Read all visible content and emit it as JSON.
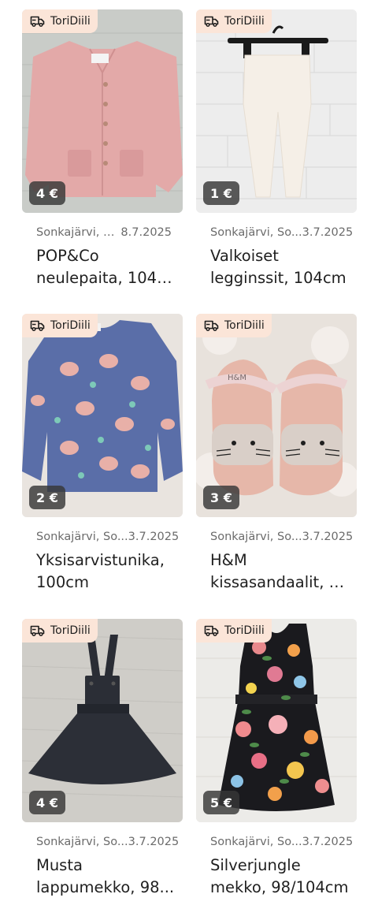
{
  "colors": {
    "badge_bg": "#fbe5d8",
    "price_bg": "#3a3a3a",
    "meta_text": "#6b6b6b",
    "title_text": "#1f1f1f"
  },
  "listings": [
    {
      "badge": "ToriDiili",
      "badge_icon": "delivery-truck-icon",
      "price": "4 €",
      "location": "Sonkajärvi, S...",
      "date": "8.7.2025",
      "title_line1": "POP&Co",
      "title_line2": "neulepaita, 104c...",
      "image": "pink-cardigan"
    },
    {
      "badge": "ToriDiili",
      "badge_icon": "delivery-truck-icon",
      "price": "1 €",
      "location": "Sonkajärvi, So...",
      "date": "3.7.2025",
      "title_line1": "Valkoiset",
      "title_line2": "legginssit, 104cm",
      "image": "white-leggings"
    },
    {
      "badge": "ToriDiili",
      "badge_icon": "delivery-truck-icon",
      "price": "2 €",
      "location": "Sonkajärvi, So...",
      "date": "3.7.2025",
      "title_line1": "Yksisarvistunika,",
      "title_line2": "100cm",
      "image": "unicorn-tunic"
    },
    {
      "badge": "ToriDiili",
      "badge_icon": "delivery-truck-icon",
      "price": "3 €",
      "location": "Sonkajärvi, So...",
      "date": "3.7.2025",
      "title_line1": "H&M",
      "title_line2": "kissasandaalit, k...",
      "image": "cat-sandals"
    },
    {
      "badge": "ToriDiili",
      "badge_icon": "delivery-truck-icon",
      "price": "4 €",
      "location": "Sonkajärvi, So...",
      "date": "3.7.2025",
      "title_line1": "Musta",
      "title_line2": "lappumekko, 98...",
      "image": "black-pinafore"
    },
    {
      "badge": "ToriDiili",
      "badge_icon": "delivery-truck-icon",
      "price": "5 €",
      "location": "Sonkajärvi, So...",
      "date": "3.7.2025",
      "title_line1": "Silverjungle",
      "title_line2": "mekko, 98/104cm",
      "image": "floral-dress"
    }
  ]
}
